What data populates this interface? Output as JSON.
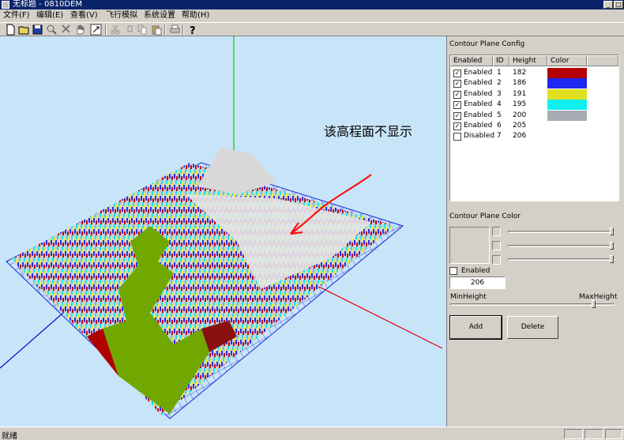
{
  "window": {
    "title": "无标题 - 0810DEM",
    "minimize": "_",
    "maximize": "□"
  },
  "menu": [
    "文件(F)",
    "编辑(E)",
    "查看(V)",
    "飞行模拟",
    "系统设置",
    "帮助(H)"
  ],
  "toolbar": [
    "new-icon",
    "open-icon",
    "save-icon",
    "zoom-icon",
    "select-icon",
    "pan-hand-icon",
    "rotate-icon",
    "cut-icon",
    "copy-icon",
    "paste-icon",
    "clipboard-icon",
    "print-icon",
    "help-icon"
  ],
  "annotation": "该高程面不显示",
  "panel": {
    "config_title": "Contour Plane Config",
    "columns": [
      "Enabled",
      "ID",
      "Height",
      "Color"
    ],
    "rows": [
      {
        "checked": true,
        "status": "Enabled",
        "id": "1",
        "height": "182",
        "color": "#b40000"
      },
      {
        "checked": true,
        "status": "Enabled",
        "id": "2",
        "height": "186",
        "color": "#1e28f0"
      },
      {
        "checked": true,
        "status": "Enabled",
        "id": "3",
        "height": "191",
        "color": "#e0e020"
      },
      {
        "checked": true,
        "status": "Enabled",
        "id": "4",
        "height": "195",
        "color": "#10f0f0"
      },
      {
        "checked": true,
        "status": "Enabled",
        "id": "5",
        "height": "200",
        "color": "#a8acb4"
      },
      {
        "checked": true,
        "status": "Enabled",
        "id": "6",
        "height": "205",
        "color": ""
      },
      {
        "checked": false,
        "status": "Disabled",
        "id": "7",
        "height": "206",
        "color": ""
      }
    ],
    "color_title": "Contour Plane Color",
    "enabled_label": "Enabled",
    "height_value": "206",
    "min_label": "MinHeight",
    "max_label": "MaxHeight",
    "add_label": "Add",
    "delete_label": "Delete"
  },
  "status": {
    "text": "就绪"
  }
}
